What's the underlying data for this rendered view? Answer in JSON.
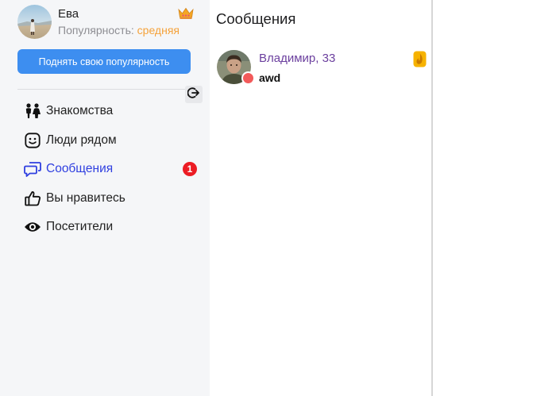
{
  "profile": {
    "name": "Ева",
    "popularity_label": "Популярность:",
    "popularity_value": "средняя"
  },
  "raise_button_label": "Поднять свою популярность",
  "nav": {
    "items": [
      {
        "label": "Знакомства",
        "icon": "couple-icon"
      },
      {
        "label": "Люди рядом",
        "icon": "smiley-icon"
      },
      {
        "label": "Сообщения",
        "icon": "chat-bubbles-icon",
        "active": true,
        "badge": "1"
      },
      {
        "label": "Вы нравитесь",
        "icon": "thumbs-up-icon"
      },
      {
        "label": "Посетители",
        "icon": "eye-icon"
      }
    ]
  },
  "messages": {
    "title": "Сообщения",
    "dialogs": [
      {
        "name": "Владимир, 33",
        "last_message": "awd",
        "status": "offline"
      }
    ]
  },
  "colors": {
    "accent": "#3d8ef0",
    "active_nav": "#2f3fe0",
    "popularity": "#f5a23a",
    "badge": "#ec1c24",
    "contact_name": "#6b3f9e",
    "status_dot": "#f25a5a"
  }
}
